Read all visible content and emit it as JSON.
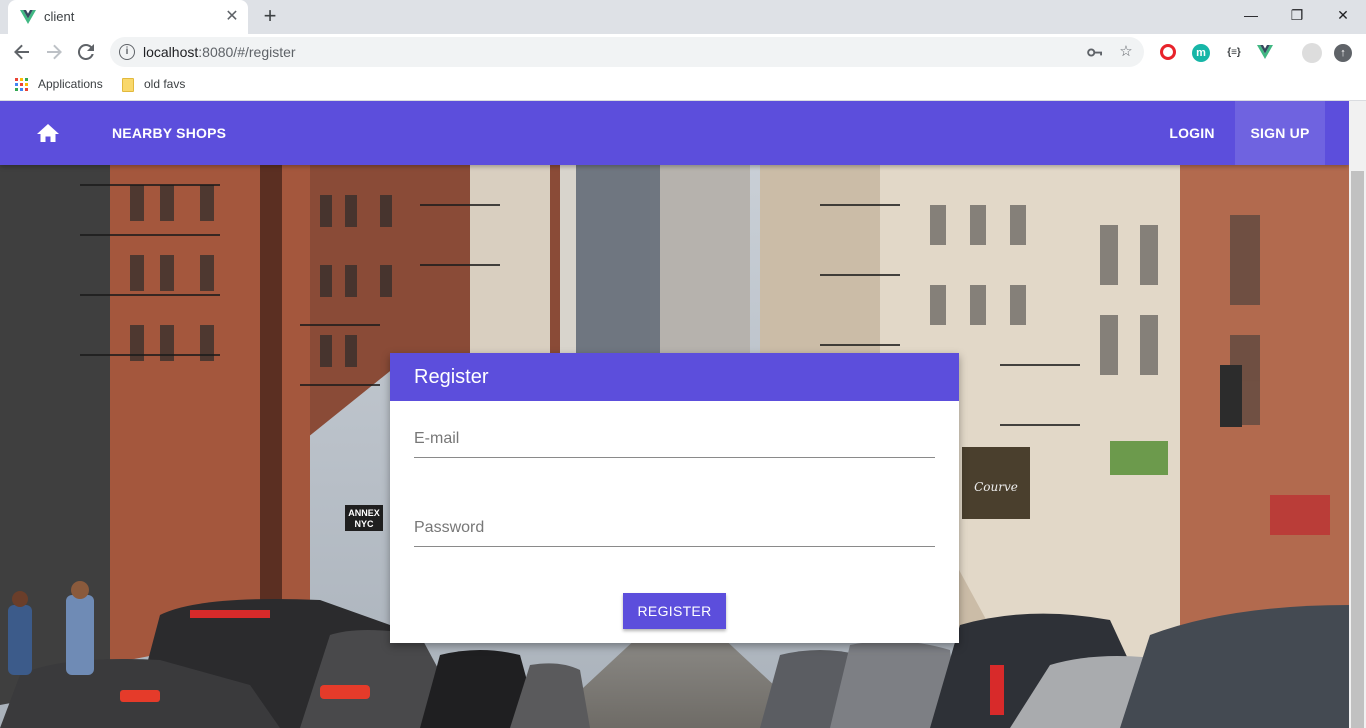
{
  "browser": {
    "tab": {
      "title": "client",
      "close": "✕"
    },
    "new_tab": "+",
    "window_controls": {
      "minimize": "—",
      "maximize": "❐",
      "close": "✕"
    },
    "url_host": "localhost",
    "url_rest": ":8080/#/register",
    "extensions": [
      {
        "name": "opera-icon",
        "glyph": "O",
        "color": "#e8232b"
      },
      {
        "name": "m-extension-icon",
        "glyph": "m",
        "color": "#17b6a7"
      },
      {
        "name": "json-extension-icon",
        "glyph": "{≡}",
        "color": "#3c4043"
      },
      {
        "name": "vue-devtools-icon",
        "glyph": "V",
        "color": "#41b883"
      }
    ],
    "bookmarks": [
      {
        "label": "Applications"
      },
      {
        "label": "old favs"
      }
    ]
  },
  "app": {
    "navbar": {
      "home_icon": "home-icon",
      "brand_link": "NEARBY SHOPS",
      "login": "LOGIN",
      "signup": "SIGN UP"
    },
    "register_card": {
      "title": "Register",
      "email_placeholder": "E-mail",
      "password_placeholder": "Password",
      "submit_label": "REGISTER"
    },
    "scene_sign_1": "ANNEX\nNYC",
    "scene_sign_2": "Courve"
  },
  "colors": {
    "primary": "#5c4edc",
    "chrome_tabstrip": "#dee1e6"
  }
}
